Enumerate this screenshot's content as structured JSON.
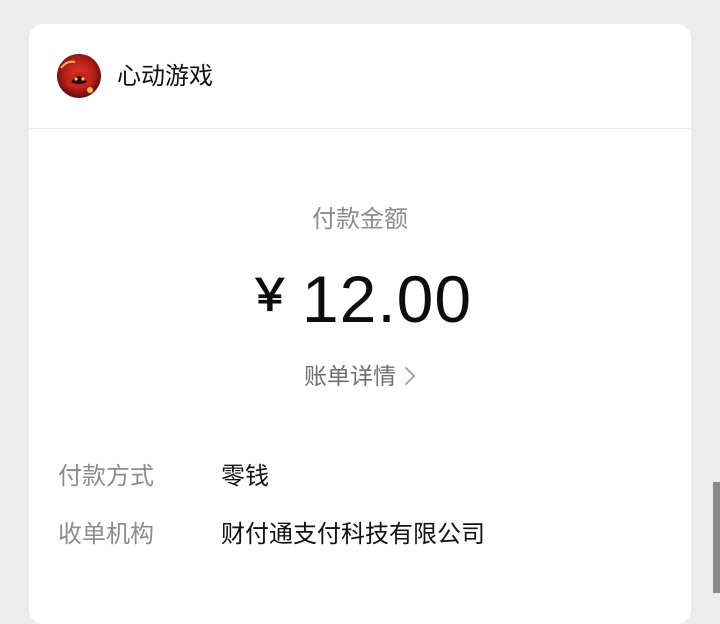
{
  "merchant": {
    "name": "心动游戏",
    "avatar_icon": "merchant-logo"
  },
  "payment": {
    "amount_label": "付款金额",
    "currency_symbol": "￥",
    "amount": "12.00",
    "details_link": "账单详情"
  },
  "info_rows": [
    {
      "label": "付款方式",
      "value": "零钱"
    },
    {
      "label": "收单机构",
      "value": "财付通支付科技有限公司"
    }
  ],
  "colors": {
    "background": "#ececec",
    "card": "#ffffff",
    "primary_text": "#111111",
    "secondary_text": "#8c8c8c",
    "link_text": "#6e6e6e"
  }
}
